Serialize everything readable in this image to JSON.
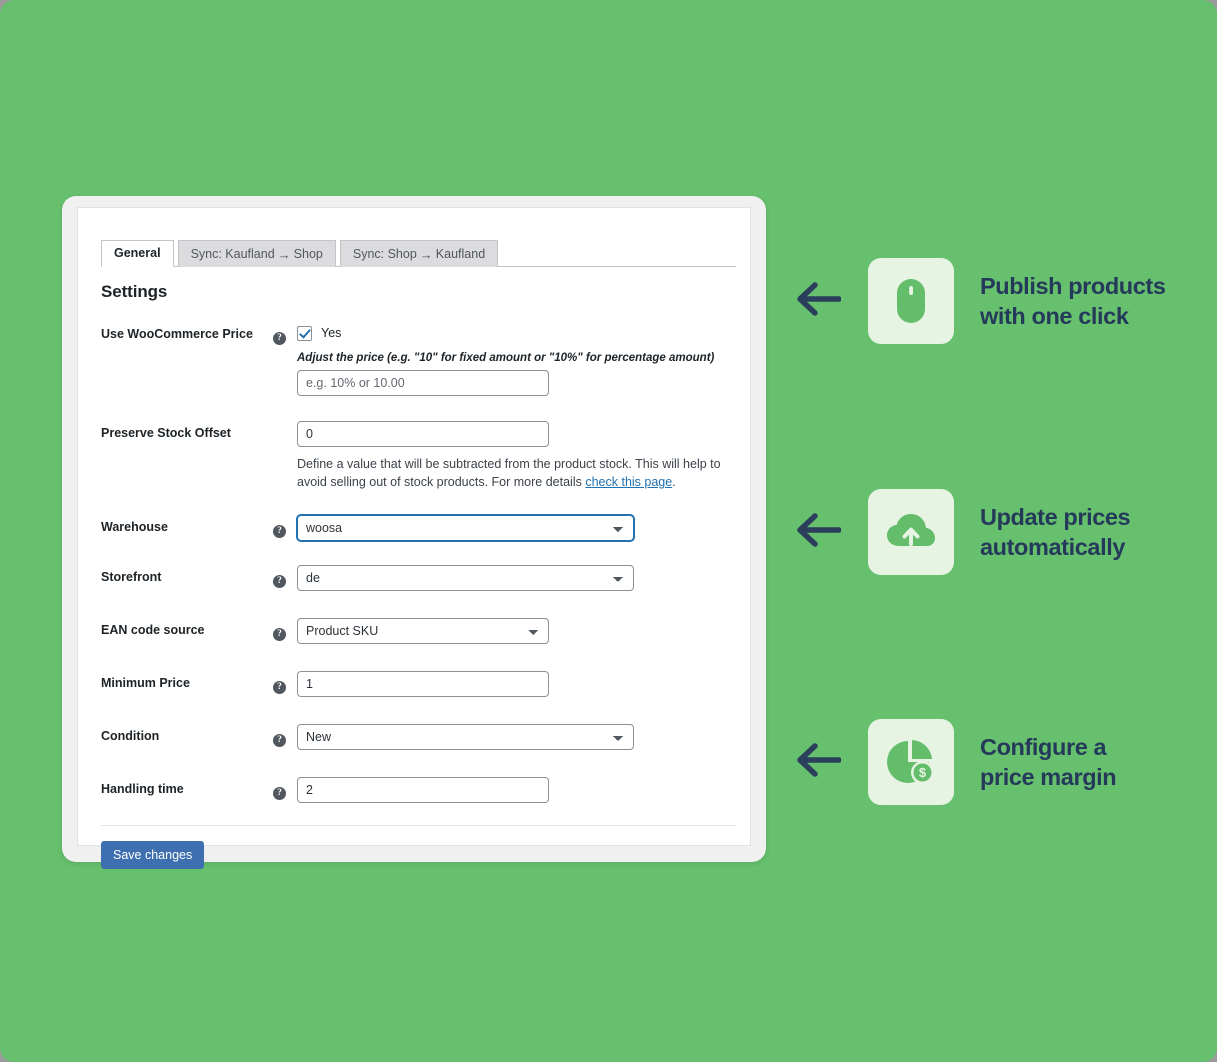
{
  "theme": {
    "background_green": "#66c06d",
    "tile_green": "#e7f4e3",
    "icon_green": "#63bd6b",
    "heading_navy": "#253a5a",
    "arrow_navy": "#2b3f5c",
    "link_blue": "#2271b1",
    "button_blue": "#3d6fb1"
  },
  "panel": {
    "tabs": [
      {
        "label": "General",
        "active": true
      },
      {
        "label_prefix": "Sync: Kaufland",
        "arrow": "→",
        "label_suffix": "Shop",
        "active": false
      },
      {
        "label_prefix": "Sync: Shop",
        "arrow": "→",
        "label_suffix": "Kaufland",
        "active": false
      }
    ],
    "heading": "Settings",
    "help_glyph": "?",
    "fields": {
      "use_woocommerce_price": {
        "label": "Use WooCommerce Price",
        "checkbox_label": "Yes",
        "checked": true,
        "hint": "Adjust the price (e.g. \"10\" for fixed amount or \"10%\" for percentage amount)",
        "placeholder": "e.g. 10% or 10.00",
        "value": ""
      },
      "preserve_stock_offset": {
        "label": "Preserve Stock Offset",
        "value": "0",
        "description_part1": "Define a value that will be subtracted from the product stock. This will help to avoid selling out of stock products. For more details ",
        "link_text": "check this page",
        "description_part2": "."
      },
      "warehouse": {
        "label": "Warehouse",
        "value": "woosa",
        "options": [
          "woosa"
        ],
        "focused": true
      },
      "storefront": {
        "label": "Storefront",
        "value": "de",
        "options": [
          "de"
        ],
        "focused": false
      },
      "ean_code_source": {
        "label": "EAN code source",
        "value": "Product SKU",
        "options": [
          "Product SKU"
        ],
        "focused": false
      },
      "minimum_price": {
        "label": "Minimum Price",
        "value": "1"
      },
      "condition": {
        "label": "Condition",
        "value": "New",
        "options": [
          "New"
        ],
        "focused": false
      },
      "handling_time": {
        "label": "Handling time",
        "value": "2"
      }
    },
    "save_label": "Save changes"
  },
  "features": [
    {
      "icon": "computer-mouse-icon",
      "line1": "Publish products",
      "line2": "with one click"
    },
    {
      "icon": "cloud-upload-icon",
      "line1": "Update prices",
      "line2": "automatically"
    },
    {
      "icon": "pie-chart-dollar-icon",
      "line1": "Configure a",
      "line2": "price margin"
    }
  ]
}
